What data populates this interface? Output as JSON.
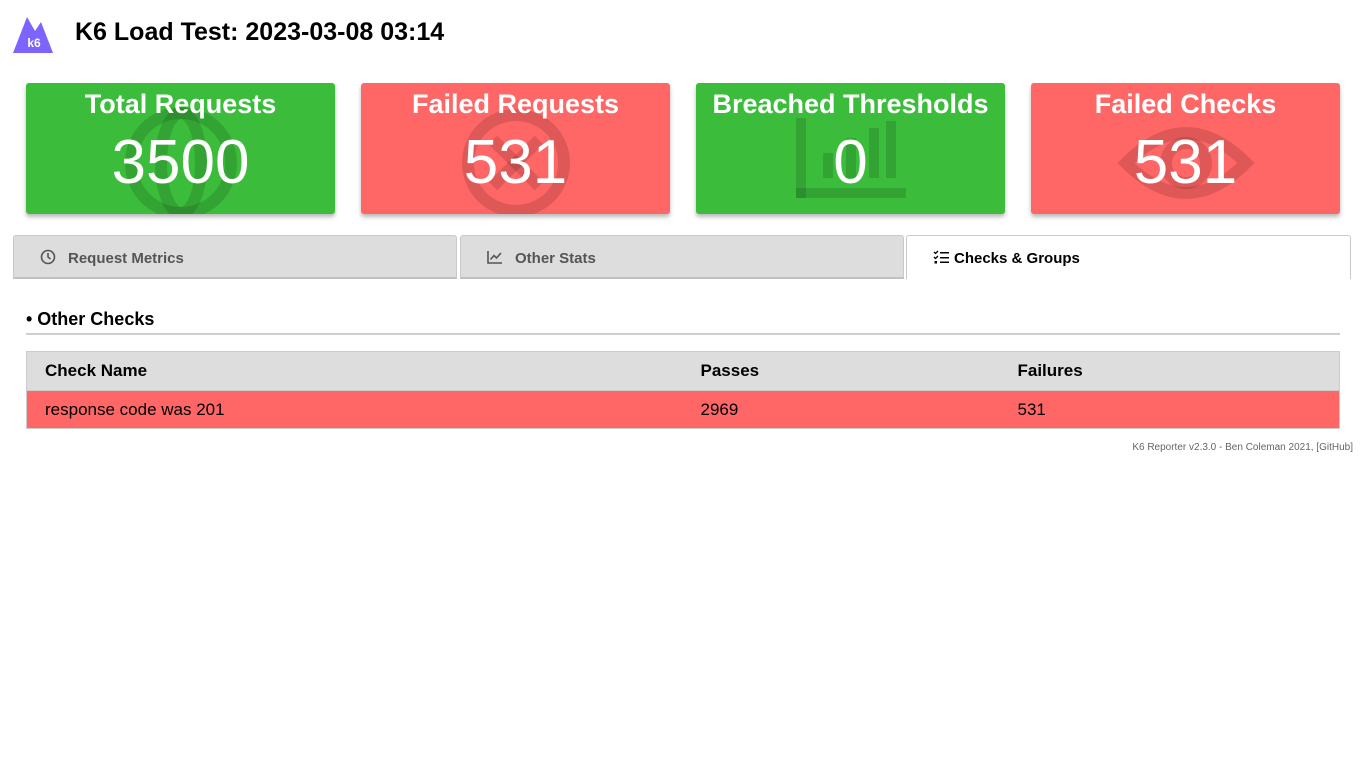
{
  "header": {
    "logo_text": "k6",
    "title": "K6 Load Test: 2023-03-08 03:14"
  },
  "stats": [
    {
      "title": "Total Requests",
      "value": "3500",
      "status": "green",
      "icon": "globe-icon"
    },
    {
      "title": "Failed Requests",
      "value": "531",
      "status": "red",
      "icon": "times-circle-icon"
    },
    {
      "title": "Breached Thresholds",
      "value": "0",
      "status": "green",
      "icon": "chart-bar-icon"
    },
    {
      "title": "Failed Checks",
      "value": "531",
      "status": "red",
      "icon": "eye-icon"
    }
  ],
  "tabs": [
    {
      "label": "Request Metrics",
      "icon": "clock-icon",
      "active": false
    },
    {
      "label": "Other Stats",
      "icon": "chart-line-icon",
      "active": false
    },
    {
      "label": "Checks & Groups",
      "icon": "tasks-icon",
      "active": true
    }
  ],
  "section": {
    "title": "• Other Checks"
  },
  "table": {
    "columns": [
      "Check Name",
      "Passes",
      "Failures"
    ],
    "rows": [
      {
        "name": "response code was 201",
        "passes": "2969",
        "failures": "531"
      }
    ]
  },
  "footer": {
    "text": "K6 Reporter v2.3.0 - Ben Coleman 2021, [GitHub]"
  },
  "colors": {
    "green": "#3bbd3b",
    "red": "#ff6666",
    "logo": "#7d64ff"
  }
}
